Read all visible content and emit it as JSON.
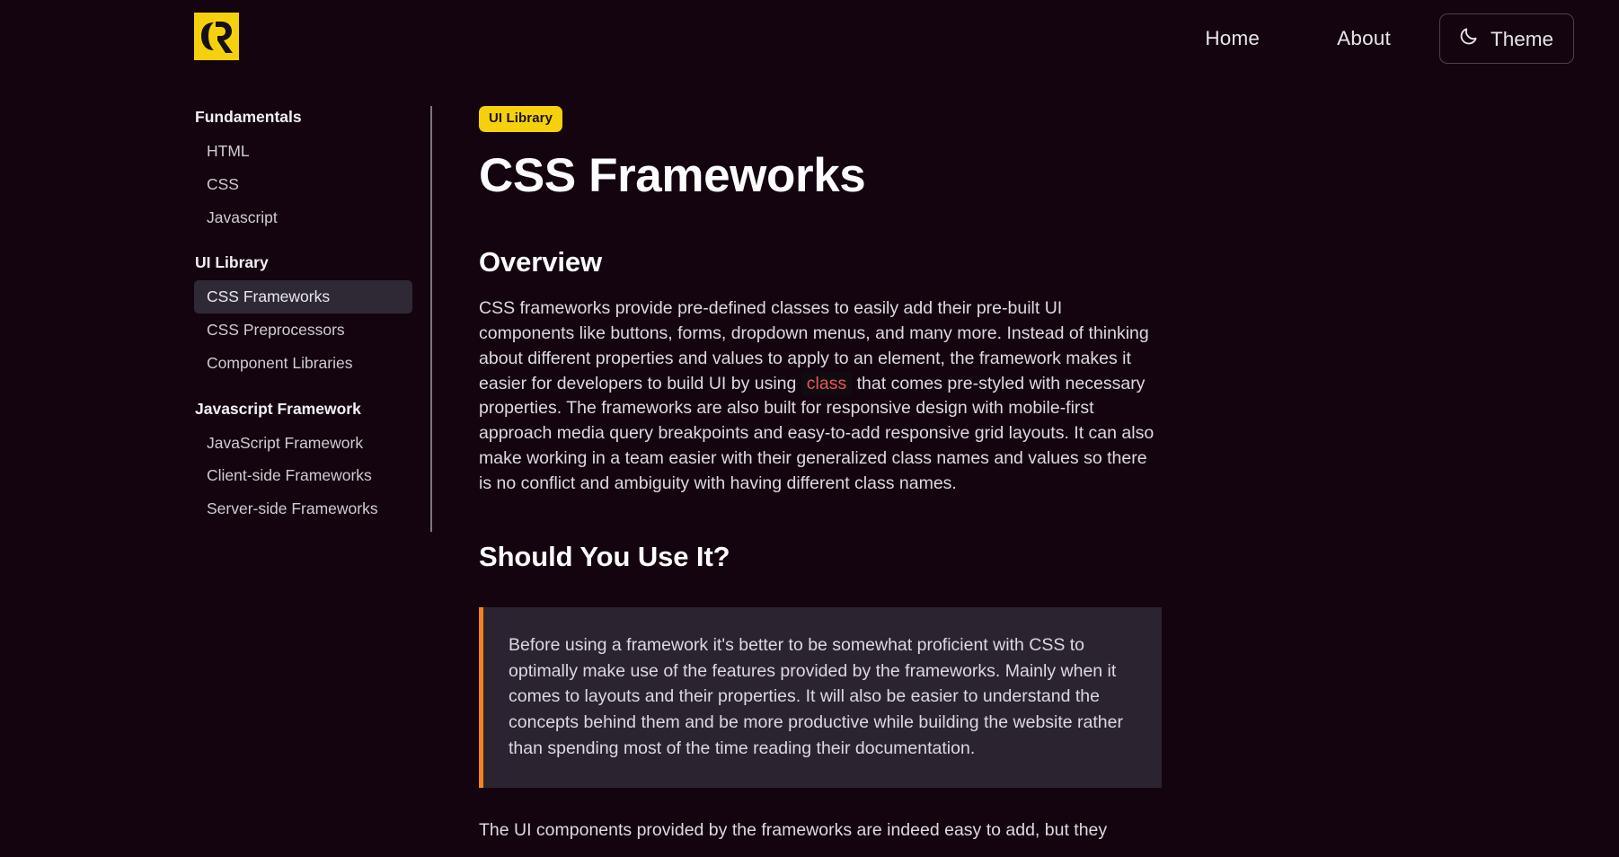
{
  "header": {
    "logo_alt": "CR logo",
    "nav": [
      {
        "label": "Home",
        "name": "nav-link-home"
      },
      {
        "label": "About",
        "name": "nav-link-about"
      }
    ],
    "theme_button": {
      "label": "Theme",
      "icon": "moon-icon"
    }
  },
  "sidebar": {
    "groups": [
      {
        "title": "Fundamentals",
        "items": [
          {
            "label": "HTML",
            "active": false
          },
          {
            "label": "CSS",
            "active": false
          },
          {
            "label": "Javascript",
            "active": false
          }
        ]
      },
      {
        "title": "UI Library",
        "items": [
          {
            "label": "CSS Frameworks",
            "active": true
          },
          {
            "label": "CSS Preprocessors",
            "active": false
          },
          {
            "label": "Component Libraries",
            "active": false
          }
        ]
      },
      {
        "title": "Javascript Framework",
        "items": [
          {
            "label": "JavaScript Framework",
            "active": false
          },
          {
            "label": "Client-side Frameworks",
            "active": false
          },
          {
            "label": "Server-side Frameworks",
            "active": false
          }
        ]
      }
    ]
  },
  "main": {
    "badge": "UI Library",
    "title": "CSS Frameworks",
    "overview_heading": "Overview",
    "overview_p1": "CSS frameworks provide pre-defined classes to easily add their pre-built UI components like buttons, forms, dropdown menus, and many more. Instead of thinking about different properties and values to apply to an element, the framework makes it easier for developers to build UI by using ",
    "overview_code": "class",
    "overview_p2": " that comes pre-styled with necessary properties. The frameworks are also built for responsive design with mobile-first approach media query breakpoints and easy-to-add responsive grid layouts. It can also make working in a team easier with their generalized class names and values so there is no conflict and ambiguity with having different class names.",
    "should_heading": "Should You Use It?",
    "callout": "Before using a framework it's better to be somewhat proficient with CSS to optimally make use of the features provided by the frameworks. Mainly when it comes to layouts and their properties. It will also be easier to understand the concepts behind them and be more productive while building the website rather than spending most of the time reading their documentation.",
    "tail": "The UI components provided by the frameworks are indeed easy to add, but they"
  },
  "colors": {
    "page_bg": "#13040f",
    "accent_yellow": "#f5d10d",
    "accent_orange": "#f4811f",
    "code_red": "#e8565a",
    "active_item_bg": "#2f2935",
    "callout_bg": "#2b2430"
  }
}
